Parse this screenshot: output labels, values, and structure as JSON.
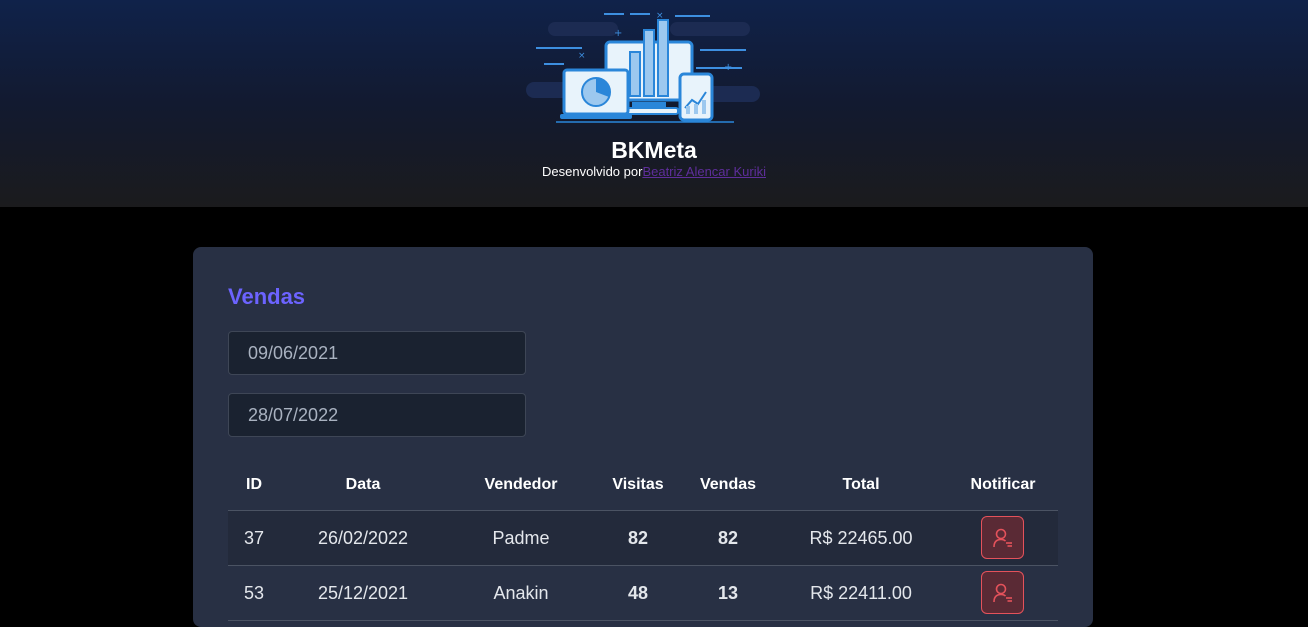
{
  "header": {
    "title": "BKMeta",
    "subtitle_prefix": "Desenvolvido por",
    "author": "Beatriz Alencar Kuriki",
    "logo_icon": "dashboard-illustration-icon"
  },
  "sales": {
    "title": "Vendas",
    "min_date": "09/06/2021",
    "max_date": "28/07/2022",
    "columns": [
      "ID",
      "Data",
      "Vendedor",
      "Visitas",
      "Vendas",
      "Total",
      "Notificar"
    ],
    "rows": [
      {
        "id": "37",
        "date": "26/02/2022",
        "seller": "Padme",
        "visits": "82",
        "deals": "82",
        "total": "R$ 22465.00"
      },
      {
        "id": "53",
        "date": "25/12/2021",
        "seller": "Anakin",
        "visits": "48",
        "deals": "13",
        "total": "R$ 22411.00"
      }
    ]
  },
  "colors": {
    "accent": "#6c63ff",
    "notify": "#e4525b",
    "card": "#283044"
  }
}
